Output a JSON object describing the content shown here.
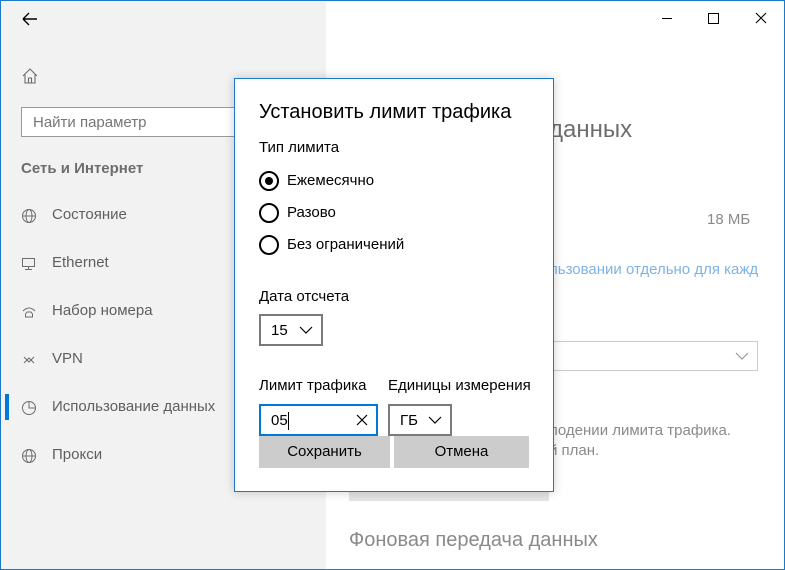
{
  "sidebar": {
    "search_placeholder": "Найти параметр",
    "section_title": "Сеть и Интернет",
    "items": [
      {
        "label": "Состояние",
        "icon": "globe-status-icon"
      },
      {
        "label": "Ethernet",
        "icon": "ethernet-icon"
      },
      {
        "label": "Набор номера",
        "icon": "dialup-icon"
      },
      {
        "label": "VPN",
        "icon": "vpn-icon"
      },
      {
        "label": "Использование данных",
        "icon": "data-usage-icon",
        "active": true
      },
      {
        "label": "Прокси",
        "icon": "globe-proxy-icon"
      }
    ]
  },
  "content": {
    "heading_partial": "данных",
    "usage_value": "18 МБ",
    "link_partial": "льзовании отдельно для кажд",
    "text_line1": "лодении лимита трафика.",
    "text_line2": "й план.",
    "subheading": "Фоновая передача данных"
  },
  "dialog": {
    "title": "Установить лимит трафика",
    "limit_type_label": "Тип лимита",
    "options": [
      {
        "label": "Ежемесячно",
        "selected": true
      },
      {
        "label": "Разово",
        "selected": false
      },
      {
        "label": "Без ограничений",
        "selected": false
      }
    ],
    "reset_date_label": "Дата отсчета",
    "reset_date_value": "15",
    "limit_label": "Лимит трафика",
    "limit_value": "05",
    "units_label": "Единицы измерения",
    "units_value": "ГБ",
    "save_label": "Сохранить",
    "cancel_label": "Отмена"
  },
  "colors": {
    "accent": "#0078d7",
    "border": "#1979ca"
  }
}
